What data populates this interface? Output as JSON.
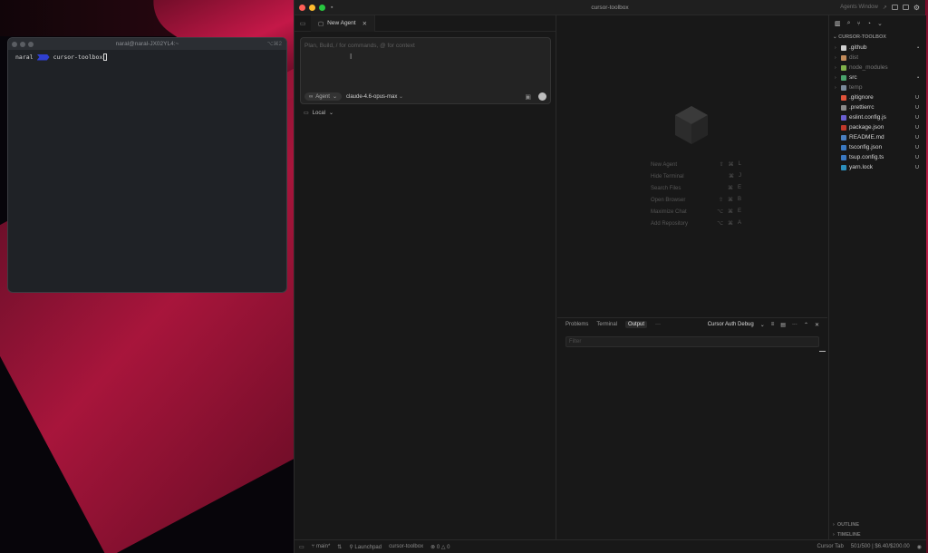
{
  "terminal": {
    "title": "naral@naral-JX02YL4:~",
    "shortcut": "⌥⌘2",
    "prompt_user": "naral",
    "prompt_dir": "cursor-toolbox"
  },
  "ide": {
    "title": "cursor-toolbox",
    "agents_window": "Agents Window"
  },
  "agent_pane": {
    "tab_label": "New Agent",
    "composer_placeholder": "Plan, Build, / for commands, @ for context",
    "mode": "Agent",
    "model": "claude-4.6-opus-max",
    "location": "Local"
  },
  "shortcuts": [
    {
      "label": "New Agent",
      "keys": [
        "⇧",
        "⌘",
        "L"
      ]
    },
    {
      "label": "Hide Terminal",
      "keys": [
        "⌘",
        "J"
      ]
    },
    {
      "label": "Search Files",
      "keys": [
        "⌘",
        "E"
      ]
    },
    {
      "label": "Open Browser",
      "keys": [
        "⇧",
        "⌘",
        "B"
      ]
    },
    {
      "label": "Maximize Chat",
      "keys": [
        "⌥",
        "⌘",
        "E"
      ]
    },
    {
      "label": "Add Repository",
      "keys": [
        "⌥",
        "⌘",
        "A"
      ]
    }
  ],
  "panel": {
    "tabs": [
      "Problems",
      "Terminal",
      "Output"
    ],
    "active_tab": "Output",
    "more": "···",
    "channel": "Cursor Auth Debug",
    "filter_placeholder": "Filter"
  },
  "explorer": {
    "header": "CURSOR-TOOLBOX",
    "items": [
      {
        "name": ".github",
        "type": "folder",
        "mark": "•",
        "color": "#cfcfcf",
        "dim": false
      },
      {
        "name": "dist",
        "type": "folder",
        "mark": "",
        "color": "#c08a5a",
        "dim": true
      },
      {
        "name": "node_modules",
        "type": "folder",
        "mark": "",
        "color": "#7fb04a",
        "dim": true
      },
      {
        "name": "src",
        "type": "folder",
        "mark": "•",
        "color": "#4aa36c",
        "dim": false
      },
      {
        "name": "temp",
        "type": "folder",
        "mark": "",
        "color": "#7a8a9a",
        "dim": true
      },
      {
        "name": ".gitignore",
        "type": "file",
        "mark": "U",
        "color": "#e0533a",
        "dim": false
      },
      {
        "name": ".prettierrc",
        "type": "file",
        "mark": "U",
        "color": "#8a8a8a",
        "dim": false
      },
      {
        "name": "eslint.config.js",
        "type": "file",
        "mark": "U",
        "color": "#6a5fd0",
        "dim": false
      },
      {
        "name": "package.json",
        "type": "file",
        "mark": "U",
        "color": "#c0392b",
        "dim": false
      },
      {
        "name": "README.md",
        "type": "file",
        "mark": "U",
        "color": "#4a7fc0",
        "dim": false
      },
      {
        "name": "tsconfig.json",
        "type": "file",
        "mark": "U",
        "color": "#3a78c0",
        "dim": false
      },
      {
        "name": "tsup.config.ts",
        "type": "file",
        "mark": "U",
        "color": "#3a78c0",
        "dim": false
      },
      {
        "name": "yarn.lock",
        "type": "file",
        "mark": "U",
        "color": "#2c8ebb",
        "dim": false
      }
    ],
    "outline": "OUTLINE",
    "timeline": "TIMELINE"
  },
  "statusbar": {
    "branch": "main*",
    "launchpad": "Launchpad",
    "repo": "cursor-toolbox",
    "errors": "0",
    "warnings": "0",
    "cursor_tab": "Cursor Tab",
    "usage": "501/500 | $6.40/$200.00"
  }
}
